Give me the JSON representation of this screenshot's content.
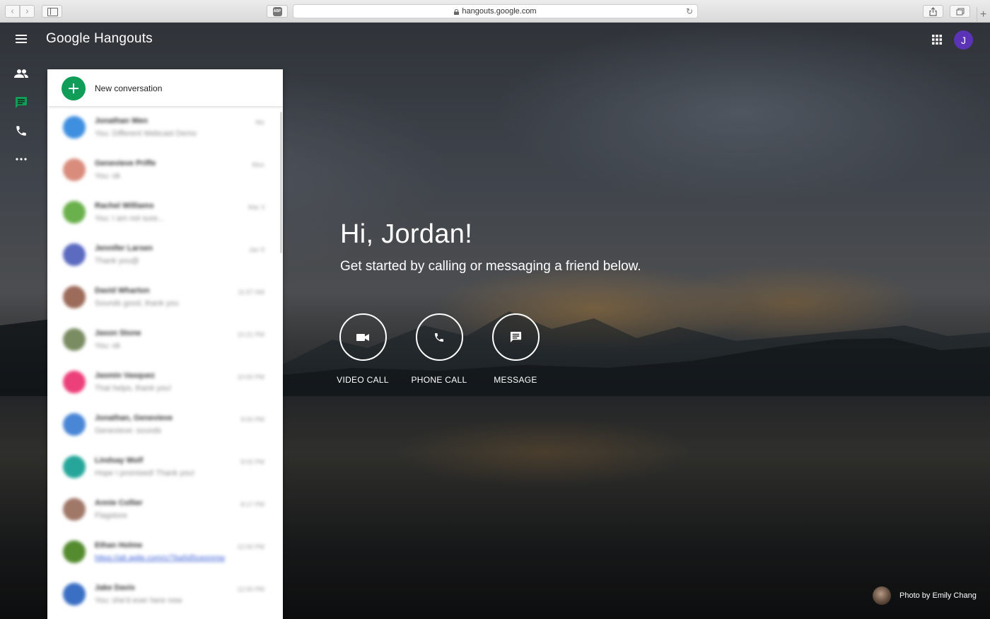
{
  "browser": {
    "url": "hangouts.google.com",
    "abp_label": "ABP",
    "back_glyph": "‹",
    "forward_glyph": "›",
    "reload_glyph": "↻",
    "new_tab_glyph": "+"
  },
  "app": {
    "title": "Google Hangouts",
    "avatar_initial": "J",
    "avatar_color": "#5b33b7",
    "accent_color": "#0f9d58"
  },
  "rail": {
    "items": [
      {
        "name": "contacts",
        "icon": "people-icon"
      },
      {
        "name": "conversations",
        "icon": "chat-icon",
        "active": true
      },
      {
        "name": "phone-calls",
        "icon": "phone-icon"
      },
      {
        "name": "more",
        "icon": "more-horiz-icon"
      }
    ]
  },
  "panel": {
    "new_conversation_label": "New conversation",
    "conversations": [
      {
        "name": "Jonathan Wen",
        "snippet": "You: Different Webcast Demo",
        "time": "Mo",
        "color": "#3f8fe0"
      },
      {
        "name": "Genevieve Priffe",
        "snippet": "You: ok",
        "time": "Mon",
        "color": "#d98c7c"
      },
      {
        "name": "Rachel Williams",
        "snippet": "You: I am not sure...",
        "time": "Mar 3",
        "color": "#6ab04c"
      },
      {
        "name": "Jennifer Larsen",
        "snippet": "Thank you@",
        "time": "Jan 9",
        "color": "#5c6bc0"
      },
      {
        "name": "David Wharton",
        "snippet": "Sounds good, thank you",
        "time": "11:57 AM",
        "color": "#9c6b5a"
      },
      {
        "name": "Jason Stone",
        "snippet": "You: ok",
        "time": "10:21 PM",
        "color": "#7a8c62"
      },
      {
        "name": "Jasmin Vasquez",
        "snippet": "That helps, thank you!",
        "time": "10:00 PM",
        "color": "#ec407a"
      },
      {
        "name": "Jonathan, Genevieve",
        "snippet": "Genevieve: sounds",
        "time": "9:00 PM",
        "color": "#4a86d6"
      },
      {
        "name": "Lindsay Wolf",
        "snippet": "Hope I promised! Thank you!",
        "time": "8:02 PM",
        "color": "#26a69a"
      },
      {
        "name": "Annie Collier",
        "snippet": "Flagstore",
        "time": "8:17 PM",
        "color": "#a07868"
      },
      {
        "name": "Ethan Holme",
        "snippet": "https://alt.agile.com/c/7ba5d5ceonmw",
        "time": "12:00 PM",
        "color": "#558b2f",
        "link": true
      },
      {
        "name": "Jake Davis",
        "snippet": "You: she'd ever here now",
        "time": "12:00 PM",
        "color": "#3b6fc4"
      }
    ]
  },
  "main": {
    "greeting": "Hi, Jordan!",
    "subtitle": "Get started by calling or messaging a friend below.",
    "actions": {
      "video_call": "VIDEO CALL",
      "phone_call": "PHONE CALL",
      "message": "MESSAGE"
    },
    "photo_credit": "Photo by Emily Chang"
  }
}
